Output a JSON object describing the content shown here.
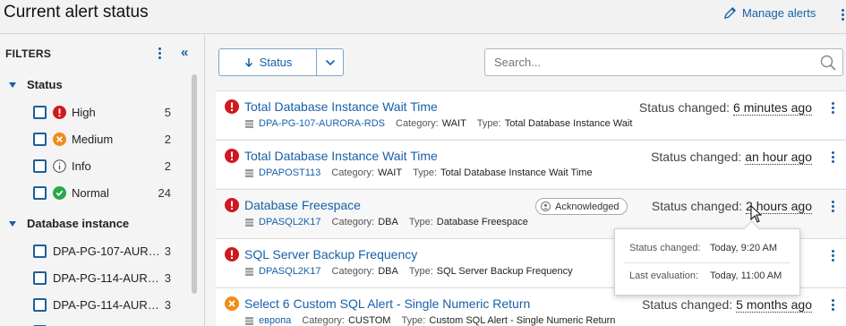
{
  "header": {
    "title": "Current alert status",
    "manage_label": "Manage alerts"
  },
  "filters": {
    "heading": "FILTERS",
    "status": {
      "title": "Status",
      "items": [
        {
          "label": "High",
          "count": "5",
          "icon": "high-severity-icon"
        },
        {
          "label": "Medium",
          "count": "2",
          "icon": "medium-severity-icon"
        },
        {
          "label": "Info",
          "count": "2",
          "icon": "info-icon"
        },
        {
          "label": "Normal",
          "count": "24",
          "icon": "normal-check-icon"
        }
      ]
    },
    "database_instance": {
      "title": "Database instance",
      "items": [
        {
          "label": "DPA-PG-107-AUR…",
          "count": "3"
        },
        {
          "label": "DPA-PG-114-AUR…",
          "count": "3"
        },
        {
          "label": "DPA-PG-114-AUR…",
          "count": "3"
        }
      ]
    }
  },
  "toolbar": {
    "status_label": "Status",
    "search_placeholder": "Search..."
  },
  "labels": {
    "category": "Category:",
    "type": "Type:",
    "status_changed": "Status changed:"
  },
  "alerts": [
    {
      "name": "Total Database Instance Wait Time",
      "instance": "DPA-PG-107-AURORA-RDS",
      "category": "WAIT",
      "type": "Total Database Instance Wait",
      "changed": "6 minutes ago",
      "severity": "high"
    },
    {
      "name": "Total Database Instance Wait Time",
      "instance": "DPAPOST113",
      "category": "WAIT",
      "type": "Total Database Instance Wait Time",
      "changed": "an hour ago",
      "severity": "high"
    },
    {
      "name": "Database Freespace",
      "instance": "DPASQL2K17",
      "category": "DBA",
      "type": "Database Freespace",
      "changed": "2 hours ago",
      "severity": "high",
      "badge": "Acknowledged"
    },
    {
      "name": "SQL Server Backup Frequency",
      "instance": "DPASQL2K17",
      "category": "DBA",
      "type": "SQL Server Backup Frequency",
      "changed": "",
      "severity": "high"
    },
    {
      "name": "Select 6 Custom SQL Alert - Single Numeric Return",
      "instance": "европа",
      "category": "CUSTOM",
      "type": "Custom SQL Alert - Single Numeric Return",
      "changed": "5 months ago",
      "severity": "medium"
    }
  ],
  "tooltip": {
    "status_changed_label": "Status changed:",
    "status_changed_value": "Today, 9:20 AM",
    "last_eval_label": "Last evaluation:",
    "last_eval_value": "Today, 11:00 AM"
  },
  "colors": {
    "accent": "#1760a8",
    "high": "#d0191f",
    "medium": "#f08c1a",
    "normal": "#2aa84a"
  }
}
